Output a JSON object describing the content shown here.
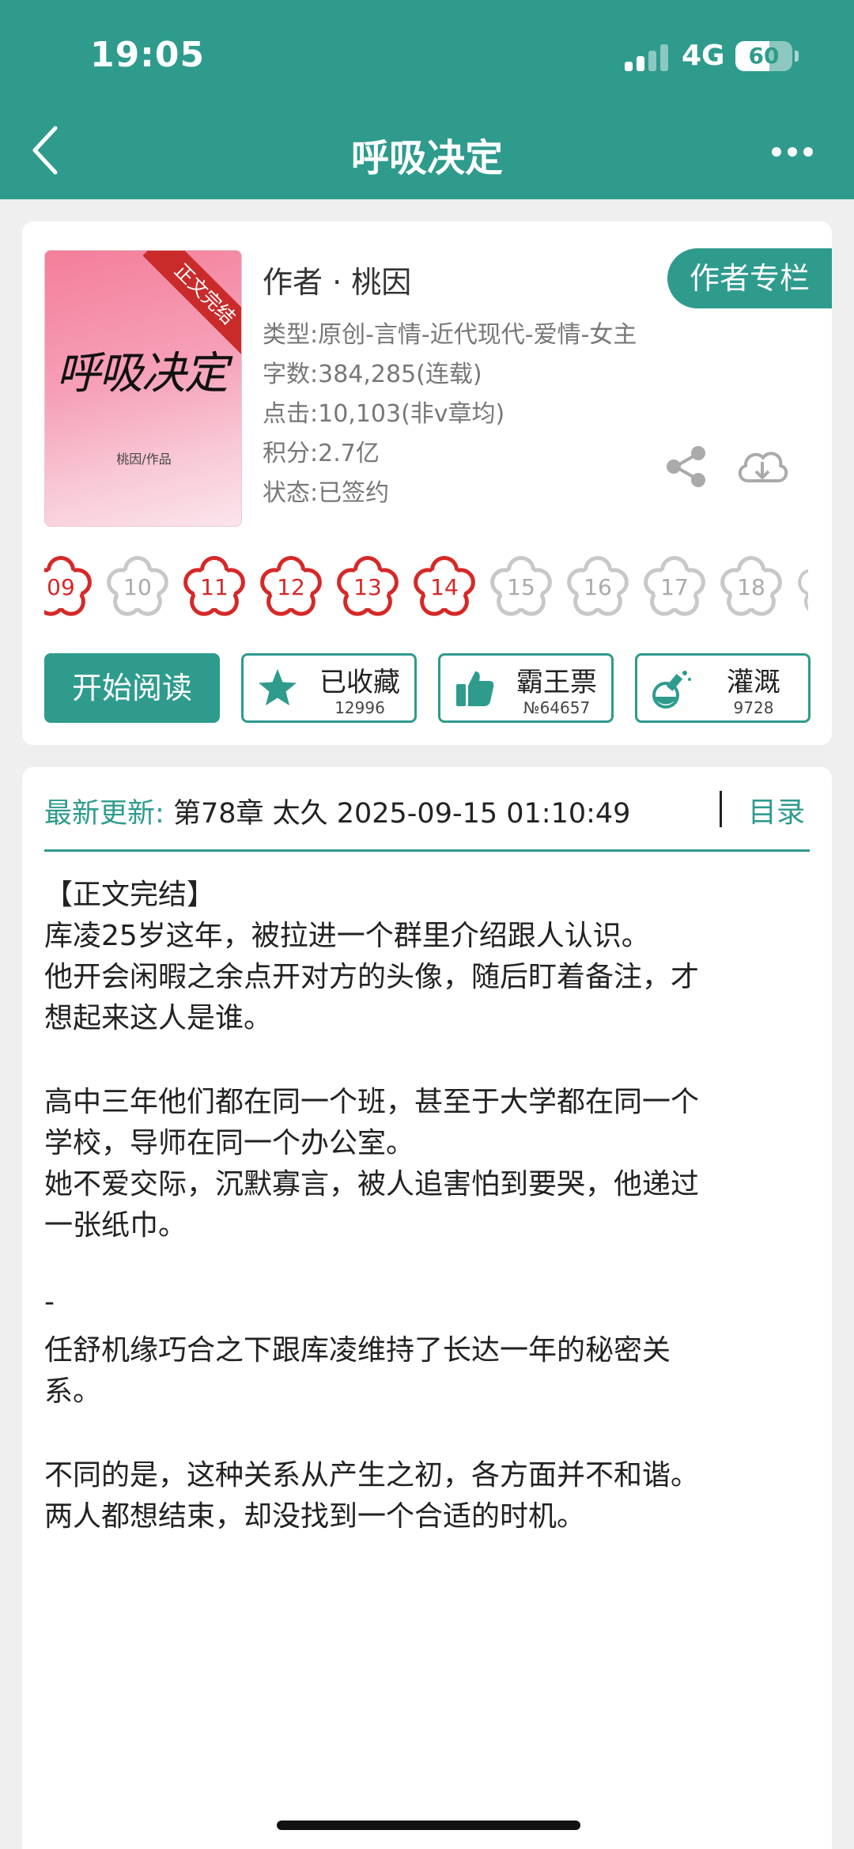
{
  "status_bar": {
    "time": "19:05",
    "network": "4G",
    "battery": "60",
    "battery_level": 0.6
  },
  "nav": {
    "title": "呼吸决定"
  },
  "book": {
    "cover": {
      "ribbon": "正文完结",
      "title": "呼吸决定",
      "author": "桃因/作品"
    },
    "author": "作者 · 桃因",
    "author_column_button": "作者专栏",
    "meta": [
      "类型:原创-言情-近代现代-爱情-女主",
      "字数:384,285(连载)",
      "点击:10,103(非v章均)",
      "积分:2.7亿",
      "状态:已签约"
    ],
    "rating_flowers": [
      {
        "label": "09",
        "active": true
      },
      {
        "label": "10",
        "active": false
      },
      {
        "label": "11",
        "active": true
      },
      {
        "label": "12",
        "active": true
      },
      {
        "label": "13",
        "active": true
      },
      {
        "label": "14",
        "active": true
      },
      {
        "label": "15",
        "active": false
      },
      {
        "label": "16",
        "active": false
      },
      {
        "label": "17",
        "active": false
      },
      {
        "label": "18",
        "active": false
      }
    ],
    "actions": {
      "read": "开始阅读",
      "collect": {
        "label": "已收藏",
        "count": "12996"
      },
      "vote": {
        "label": "霸王票",
        "count": "№64657"
      },
      "water": {
        "label": "灌溉",
        "count": "9728"
      }
    }
  },
  "update": {
    "label": "最新更新:",
    "value": "第78章 太久 2025-09-15 01:10:49",
    "toc": "目录"
  },
  "summary": [
    "【正文完结】",
    "库凌25岁这年，被拉进一个群里介绍跟人认识。",
    "他开会闲暇之余点开对方的头像，随后盯着备注，才",
    "想起来这人是谁。",
    "高中三年他们都在同一个班，甚至于大学都在同一个",
    "学校，导师在同一个办公室。",
    "她不爱交际，沉默寡言，被人追害怕到要哭，他递过",
    "一张纸巾。",
    "-",
    "任舒机缘巧合之下跟库凌维持了长达一年的秘密关",
    "系。",
    "不同的是，这种关系从产生之初，各方面并不和谐。",
    "两人都想结束，却没找到一个合适的时机。"
  ],
  "colors": {
    "accent": "#2e9b8d",
    "flower_active": "#d62828",
    "flower_inactive": "#c8c8c8"
  }
}
